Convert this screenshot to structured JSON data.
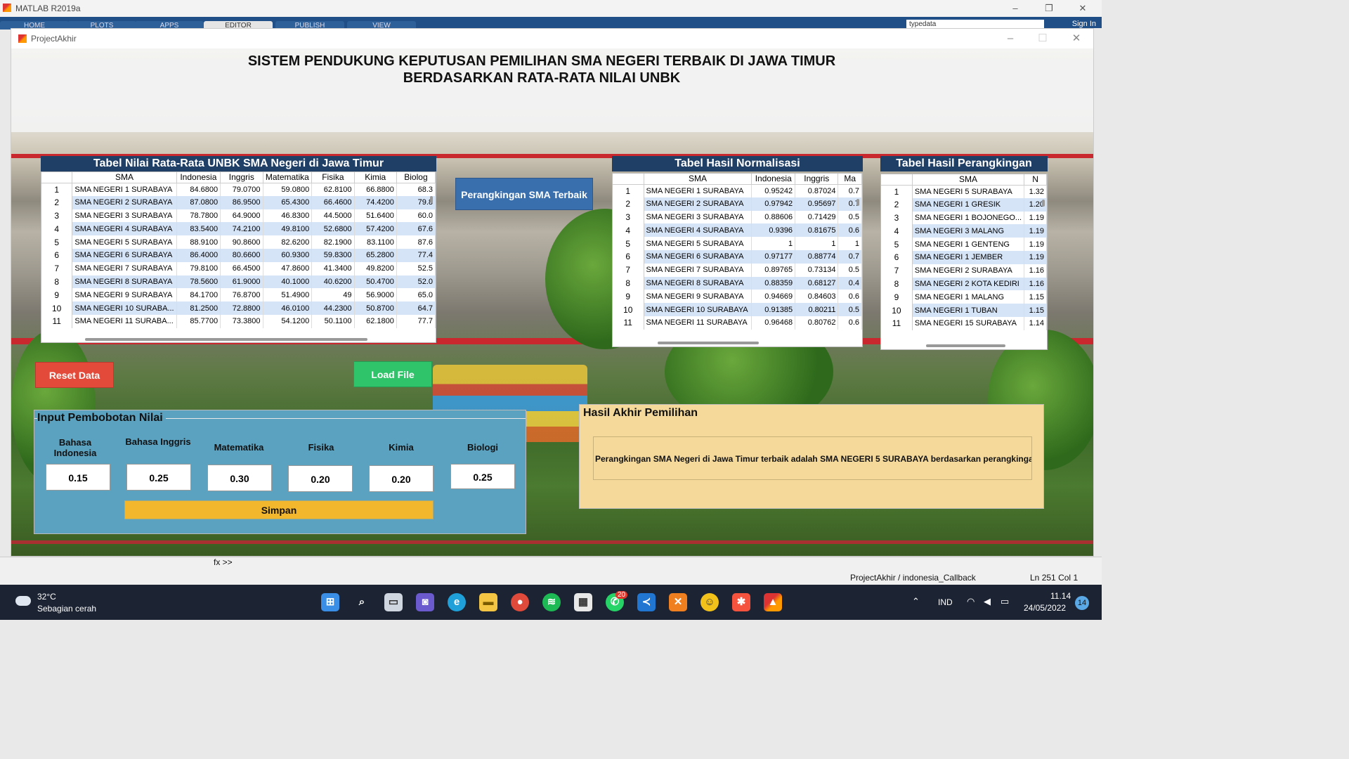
{
  "matlab": {
    "title": "MATLAB R2019a",
    "tabs": [
      "HOME",
      "PLOTS",
      "APPS",
      "EDITOR",
      "PUBLISH",
      "VIEW"
    ],
    "active_tab": "EDITOR",
    "search_value": "typedata",
    "sign_in": "Sign In",
    "command_prompt": "fx >>",
    "status_callback": "ProjectAkhir / indonesia_Callback",
    "status_ln_label": "Ln",
    "status_ln": "251",
    "status_col_label": "Col",
    "status_col": "1"
  },
  "app": {
    "window_title": "ProjectAkhir",
    "title_line1": "SISTEM PENDUKUNG KEPUTUSAN PEMILIHAN SMA NEGERI TERBAIK DI JAWA TIMUR",
    "title_line2": "BERDASARKAN RATA-RATA NILAI UNBK",
    "buttons": {
      "rank": "Perangkingan SMA Terbaik",
      "reset": "Reset Data",
      "load": "Load File",
      "save": "Simpan"
    },
    "table_nilai": {
      "title": "Tabel Nilai Rata-Rata UNBK SMA Negeri di Jawa Timur",
      "columns": [
        "SMA",
        "Indonesia",
        "Inggris",
        "Matematika",
        "Fisika",
        "Kimia",
        "Biolog"
      ],
      "rows": [
        [
          "1",
          "SMA NEGERI 1 SURABAYA",
          "84.6800",
          "79.0700",
          "59.0800",
          "62.8100",
          "66.8800",
          "68.3"
        ],
        [
          "2",
          "SMA NEGERI 2 SURABAYA",
          "87.0800",
          "86.9500",
          "65.4300",
          "66.4600",
          "74.4200",
          "79.8"
        ],
        [
          "3",
          "SMA NEGERI 3 SURABAYA",
          "78.7800",
          "64.9000",
          "46.8300",
          "44.5000",
          "51.6400",
          "60.0"
        ],
        [
          "4",
          "SMA NEGERI 4 SURABAYA",
          "83.5400",
          "74.2100",
          "49.8100",
          "52.6800",
          "57.4200",
          "67.6"
        ],
        [
          "5",
          "SMA NEGERI 5 SURABAYA",
          "88.9100",
          "90.8600",
          "82.6200",
          "82.1900",
          "83.1100",
          "87.6"
        ],
        [
          "6",
          "SMA NEGERI 6 SURABAYA",
          "86.4000",
          "80.6600",
          "60.9300",
          "59.8300",
          "65.2800",
          "77.4"
        ],
        [
          "7",
          "SMA NEGERI 7 SURABAYA",
          "79.8100",
          "66.4500",
          "47.8600",
          "41.3400",
          "49.8200",
          "52.5"
        ],
        [
          "8",
          "SMA NEGERI 8 SURABAYA",
          "78.5600",
          "61.9000",
          "40.1000",
          "40.6200",
          "50.4700",
          "52.0"
        ],
        [
          "9",
          "SMA NEGERI 9 SURABAYA",
          "84.1700",
          "76.8700",
          "51.4900",
          "49",
          "56.9000",
          "65.0"
        ],
        [
          "10",
          "SMA NEGERI 10 SURABA...",
          "81.2500",
          "72.8800",
          "46.0100",
          "44.2300",
          "50.8700",
          "64.7"
        ],
        [
          "11",
          "SMA NEGERI 11 SURABA...",
          "85.7700",
          "73.3800",
          "54.1200",
          "50.1100",
          "62.1800",
          "77.7"
        ]
      ]
    },
    "table_norm": {
      "title": "Tabel Hasil Normalisasi",
      "columns": [
        "SMA",
        "Indonesia",
        "Inggris",
        "Ma"
      ],
      "rows": [
        [
          "1",
          "SMA NEGERI 1 SURABAYA",
          "0.95242",
          "0.87024",
          "0.7"
        ],
        [
          "2",
          "SMA NEGERI 2 SURABAYA",
          "0.97942",
          "0.95697",
          "0.7"
        ],
        [
          "3",
          "SMA NEGERI 3 SURABAYA",
          "0.88606",
          "0.71429",
          "0.5"
        ],
        [
          "4",
          "SMA NEGERI 4 SURABAYA",
          "0.9396",
          "0.81675",
          "0.6"
        ],
        [
          "5",
          "SMA NEGERI 5 SURABAYA",
          "1",
          "1",
          "1"
        ],
        [
          "6",
          "SMA NEGERI 6 SURABAYA",
          "0.97177",
          "0.88774",
          "0.7"
        ],
        [
          "7",
          "SMA NEGERI 7 SURABAYA",
          "0.89765",
          "0.73134",
          "0.5"
        ],
        [
          "8",
          "SMA NEGERI 8 SURABAYA",
          "0.88359",
          "0.68127",
          "0.4"
        ],
        [
          "9",
          "SMA NEGERI 9 SURABAYA",
          "0.94669",
          "0.84603",
          "0.6"
        ],
        [
          "10",
          "SMA NEGERI 10 SURABAYA",
          "0.91385",
          "0.80211",
          "0.5"
        ],
        [
          "11",
          "SMA NEGERI 11 SURABAYA",
          "0.96468",
          "0.80762",
          "0.6"
        ]
      ]
    },
    "table_rank": {
      "title": "Tabel Hasil Perangkingan",
      "columns": [
        "SMA",
        "N"
      ],
      "rows": [
        [
          "1",
          "SMA NEGERI 5 SURABAYA",
          "1.32"
        ],
        [
          "2",
          "SMA NEGERI 1 GRESIK",
          "1.20"
        ],
        [
          "3",
          "SMA NEGERI 1 BOJONEGO...",
          "1.19"
        ],
        [
          "4",
          "SMA NEGERI 3 MALANG",
          "1.19"
        ],
        [
          "5",
          "SMA NEGERI 1 GENTENG",
          "1.19"
        ],
        [
          "6",
          "SMA NEGERI 1 JEMBER",
          "1.19"
        ],
        [
          "7",
          "SMA NEGERI 2 SURABAYA",
          "1.16"
        ],
        [
          "8",
          "SMA NEGERI 2 KOTA KEDIRI",
          "1.16"
        ],
        [
          "9",
          "SMA NEGERI 1 MALANG",
          "1.15"
        ],
        [
          "10",
          "SMA NEGERI 1 TUBAN",
          "1.15"
        ],
        [
          "11",
          "SMA NEGERI 15 SURABAYA",
          "1.14"
        ]
      ]
    },
    "input_panel": {
      "title": "Input Pembobotan Nilai",
      "fields": [
        {
          "label": "Bahasa Indonesia",
          "value": "0.15"
        },
        {
          "label": "Bahasa Inggris",
          "value": "0.25"
        },
        {
          "label": "Matematika",
          "value": "0.30"
        },
        {
          "label": "Fisika",
          "value": "0.20"
        },
        {
          "label": "Kimia",
          "value": "0.20"
        },
        {
          "label": "Biologi",
          "value": "0.25"
        }
      ]
    },
    "hasil_panel": {
      "title": "Hasil Akhir Pemilihan",
      "text": "Perangkingan SMA Negeri di Jawa Timur terbaik adalah SMA NEGERI 5 SURABAYA berdasarkan perangkinga"
    }
  },
  "taskbar": {
    "temperature": "32°C",
    "weather": "Sebagian cerah",
    "language": "IND",
    "time": "11.14",
    "date": "24/05/2022",
    "whatsapp_badge": "20",
    "notification_count": "14"
  },
  "colors": {
    "table_header": "#1f3f66",
    "rank_button": "#3a6fae",
    "reset_button": "#e34a3a",
    "load_button": "#2fc46a",
    "save_button": "#f3b72d",
    "input_panel": "#5ba2c1",
    "result_panel": "#f4d99a"
  }
}
